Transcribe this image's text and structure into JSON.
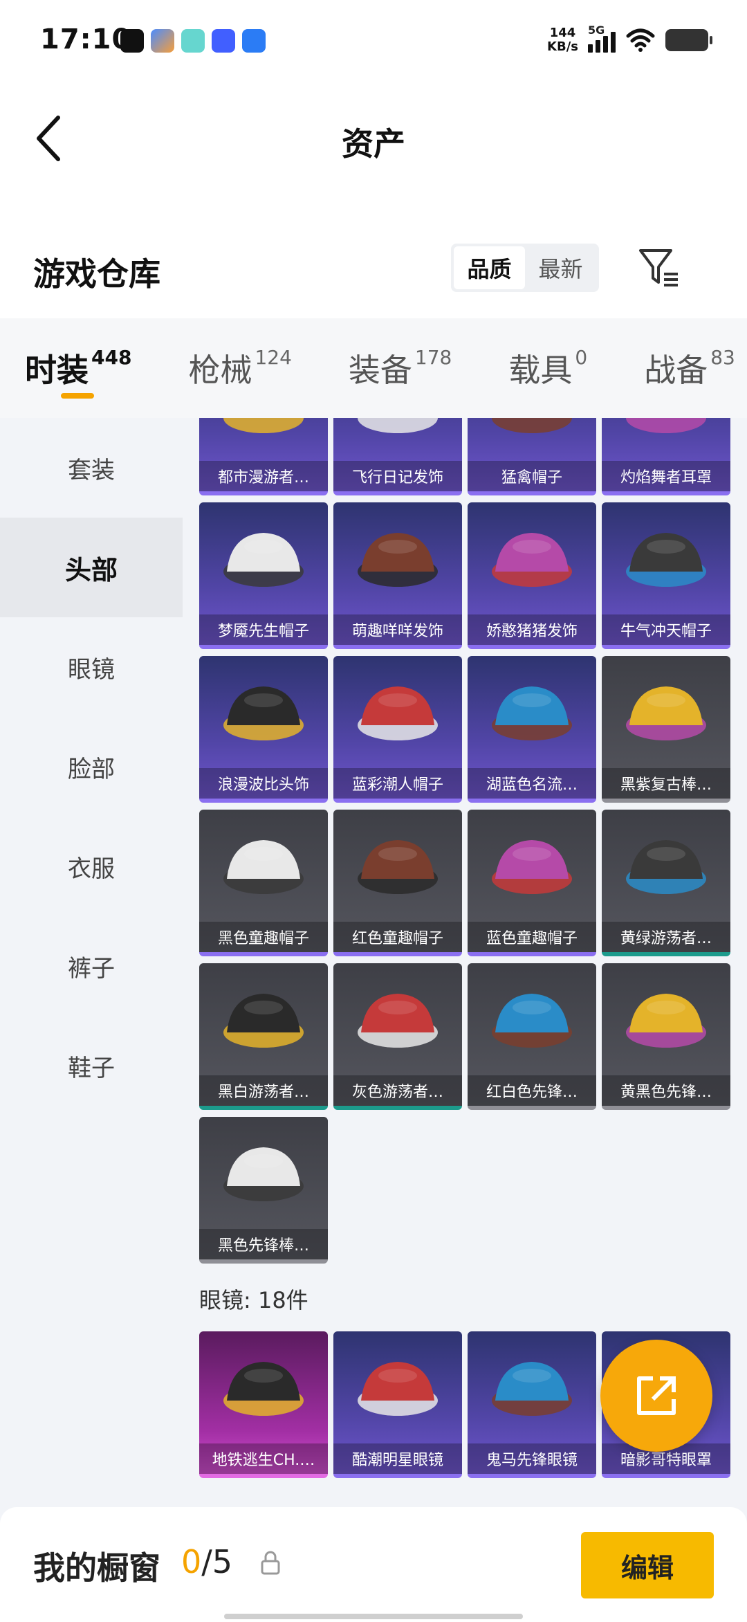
{
  "status": {
    "time": "17:10",
    "net_speed_value": "144",
    "net_speed_unit": "KB/s",
    "network": "5G"
  },
  "header": {
    "title": "资产"
  },
  "section": {
    "title": "游戏仓库",
    "sort_options": [
      "品质",
      "最新"
    ],
    "sort_selected": "品质"
  },
  "tabs": [
    {
      "label": "时装",
      "count": "448"
    },
    {
      "label": "枪械",
      "count": "124"
    },
    {
      "label": "装备",
      "count": "178"
    },
    {
      "label": "载具",
      "count": "0"
    },
    {
      "label": "战备",
      "count": "83"
    }
  ],
  "sidebar": [
    {
      "label": "套装"
    },
    {
      "label": "头部"
    },
    {
      "label": "眼镜"
    },
    {
      "label": "脸部"
    },
    {
      "label": "衣服"
    },
    {
      "label": "裤子"
    },
    {
      "label": "鞋子"
    }
  ],
  "head_items": [
    {
      "name": "都市漫游者…",
      "tier": "purple"
    },
    {
      "name": "飞行日记发饰",
      "tier": "purple"
    },
    {
      "name": "猛禽帽子",
      "tier": "purple"
    },
    {
      "name": "灼焰舞者耳罩",
      "tier": "purple"
    },
    {
      "name": "梦魇先生帽子",
      "tier": "purple"
    },
    {
      "name": "萌趣咩咩发饰",
      "tier": "purple"
    },
    {
      "name": "娇憨猪猪发饰",
      "tier": "purple"
    },
    {
      "name": "牛气冲天帽子",
      "tier": "purple"
    },
    {
      "name": "浪漫波比头饰",
      "tier": "purple"
    },
    {
      "name": "蓝彩潮人帽子",
      "tier": "purple"
    },
    {
      "name": "湖蓝色名流…",
      "tier": "purple"
    },
    {
      "name": "黑紫复古棒…",
      "tier": "gray"
    },
    {
      "name": "黑色童趣帽子",
      "tier": "gray-purple"
    },
    {
      "name": "红色童趣帽子",
      "tier": "gray-purple"
    },
    {
      "name": "蓝色童趣帽子",
      "tier": "gray-purple"
    },
    {
      "name": "黄绿游荡者…",
      "tier": "gray-green"
    },
    {
      "name": "黑白游荡者…",
      "tier": "gray-green"
    },
    {
      "name": "灰色游荡者…",
      "tier": "gray-green"
    },
    {
      "name": "红白色先锋…",
      "tier": "gray"
    },
    {
      "name": "黄黑色先锋…",
      "tier": "gray"
    },
    {
      "name": "黑色先锋棒…",
      "tier": "gray"
    }
  ],
  "glasses_header": "眼镜: 18件",
  "glasses_items": [
    {
      "name": "地铁逃生CH.…",
      "tier": "pink"
    },
    {
      "name": "酷潮明星眼镜",
      "tier": "purple"
    },
    {
      "name": "鬼马先锋眼镜",
      "tier": "purple"
    },
    {
      "name": "暗影哥特眼罩",
      "tier": "purple"
    }
  ],
  "bottom": {
    "label": "我的橱窗",
    "count_current": "0",
    "count_total": "/5",
    "edit_label": "编辑"
  },
  "colors": {
    "accent": "#f5a300",
    "purple_card": "#5145a6",
    "gray_card": "#4a4b52",
    "pink_card": "#a22fa4"
  }
}
